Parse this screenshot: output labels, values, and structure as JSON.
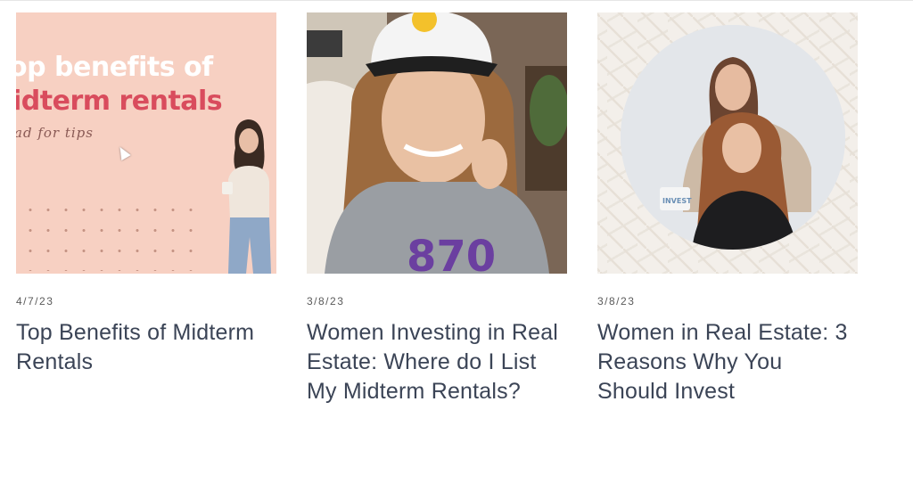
{
  "posts": [
    {
      "date": "4/7/23",
      "title": "Top Benefits of Midterm Rentals",
      "thumbnail": {
        "line1": "op benefits of",
        "line2": "idterm rentals",
        "line3": "ad for tips",
        "bg_color": "#f7d0c2",
        "accent_color": "#d94c5d"
      }
    },
    {
      "date": "3/8/23",
      "title": "Women Investing in Real Estate: Where do I List My Midterm Rentals?",
      "thumbnail": {
        "shirt_text": "870"
      }
    },
    {
      "date": "3/8/23",
      "title": "Women in Real Estate: 3 Reasons Why You Should Invest",
      "thumbnail": {
        "mug_text": "INVEST"
      }
    }
  ],
  "colors": {
    "title": "#3b4456",
    "date": "#5a5a5a"
  }
}
